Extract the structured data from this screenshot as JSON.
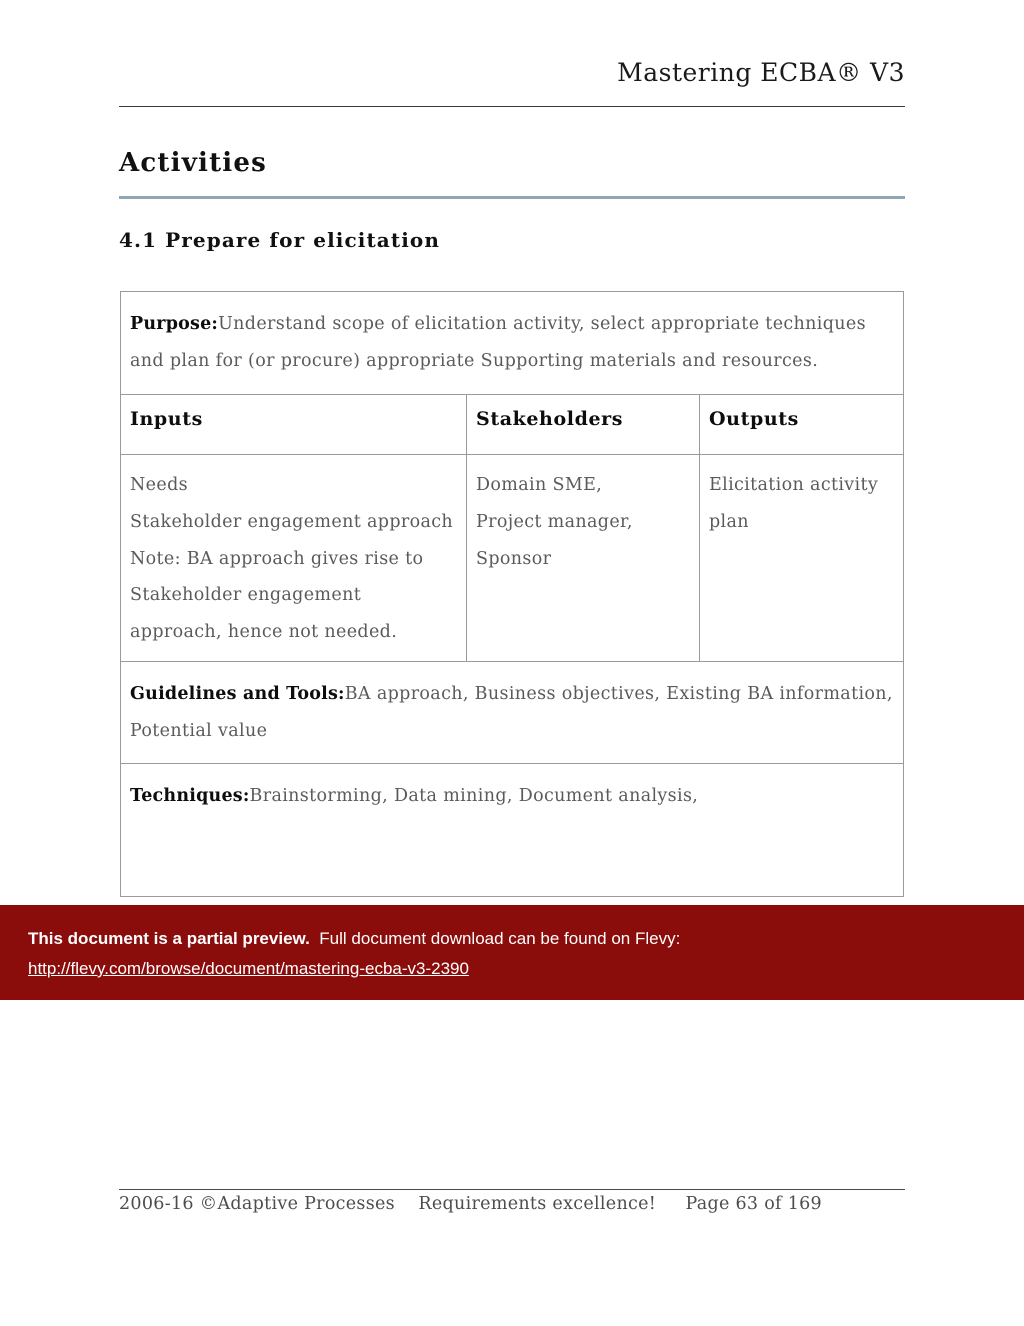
{
  "document": {
    "header_title": "Mastering ECBA® V3",
    "section_title": "Activities",
    "sub_title": "4.1 Prepare for elicitation",
    "accent_rule_color": "#90a8b6"
  },
  "activity_table": {
    "purpose": {
      "label": "Purpose:",
      "text": "Understand scope of elicitation activity, select appropriate techniques and plan for (or procure) appropriate Supporting materials and resources."
    },
    "column_headers": [
      "Inputs",
      "Stakeholders",
      "Outputs"
    ],
    "inputs": [
      "Needs",
      "Stakeholder engagement approach",
      "Note: BA approach gives rise to Stakeholder engagement approach, hence not needed."
    ],
    "stakeholders": [
      "Domain SME,",
      "Project manager,",
      "Sponsor"
    ],
    "outputs": [
      "Elicitation activity plan"
    ],
    "guidelines": {
      "label": "Guidelines and Tools:",
      "text": "BA approach, Business objectives, Existing BA information, Potential value"
    },
    "techniques": {
      "label": "Techniques:",
      "text": "Brainstorming, Data mining, Document analysis,"
    }
  },
  "preview_banner": {
    "bold_text": "This document is a partial preview.",
    "rest_text": "Full document download can be found on Flevy:",
    "url": "http://flevy.com/browse/document/mastering-ecba-v3-2390",
    "background_color": "#8b0d0b"
  },
  "footer": {
    "copyright": "2006-16 ©Adaptive Processes",
    "tagline": "Requirements excellence!",
    "page_number": "Page 63 of 169",
    "gap1": "    ",
    "gap2": "     "
  }
}
